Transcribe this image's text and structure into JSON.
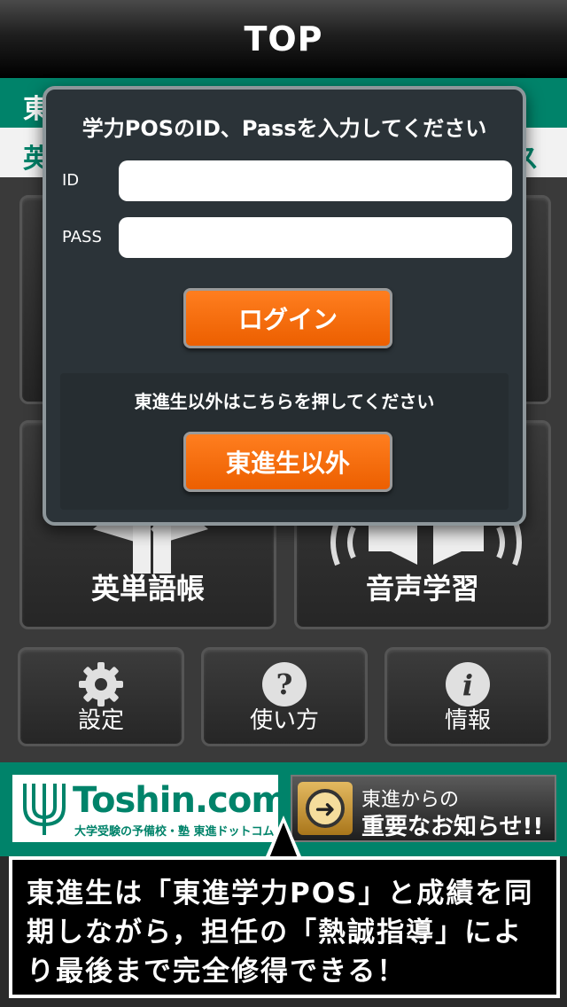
{
  "navbar": {
    "title": "TOP"
  },
  "band": {
    "frag_a": "東",
    "frag_b": "英",
    "frag_c": "ス"
  },
  "tiles": {
    "vocab_label": "英単語帳",
    "audio_label": "音声学習"
  },
  "small_tiles": {
    "settings_label": "設定",
    "howto_label": "使い方",
    "info_label": "情報"
  },
  "banner": {
    "logo_text": "Toshin.com",
    "tagline": "大学受験の予備校・塾 東進ドットコム",
    "notice_line1": "東進からの",
    "notice_line2": "重要なお知らせ!!"
  },
  "caption": {
    "text": "東進生は「東進学力POS」と成績を同期しながら，担任の「熱誠指導」により最後まで完全修得できる！"
  },
  "dialog": {
    "title": "学力POSのID、Passを入力してください",
    "id_label": "ID",
    "pass_label": "PASS",
    "id_value": "",
    "pass_value": "",
    "login_label": "ログイン",
    "guest_prompt": "東進生以外はこちらを押してください",
    "guest_label": "東進生以外"
  },
  "colors": {
    "accent_green": "#00836a",
    "button_orange": "#f56a00",
    "dialog_bg": "#2b3338"
  },
  "icons": [
    "gear-icon",
    "question-icon",
    "info-icon",
    "arrow-right-icon",
    "toshin-logo"
  ]
}
